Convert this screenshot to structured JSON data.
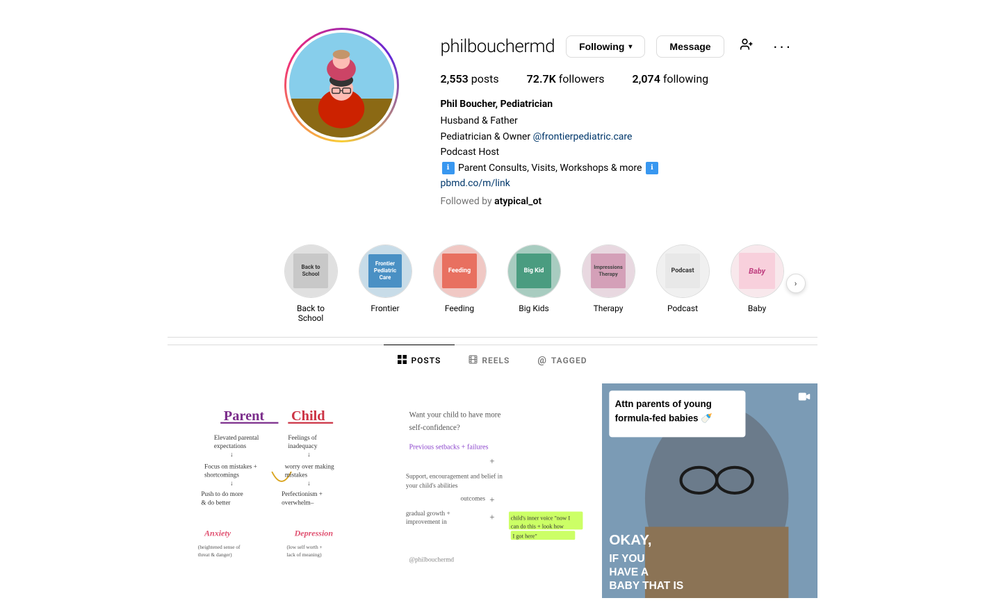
{
  "profile": {
    "username": "philbouchermd",
    "following_button": "Following",
    "message_button": "Message",
    "stats": {
      "posts_count": "2,553",
      "posts_label": "posts",
      "followers_count": "72.7K",
      "followers_label": "followers",
      "following_count": "2,074",
      "following_label": "following"
    },
    "bio": {
      "name": "Phil Boucher, Pediatrician",
      "line1": "Husband & Father",
      "line2": "Pediatrician & Owner @frontierpediatric.care",
      "line3": "Podcast Host",
      "line4": "Parent Consults, Visits, Workshops & more",
      "link": "pbmd.co/m/link",
      "followed_by": "Followed by",
      "follower_name": "atypical_ot"
    }
  },
  "highlights": [
    {
      "id": "back-to-school",
      "label": "Back to School",
      "bg_color": "#d4d4d4",
      "note_color": "#c8c8c8",
      "note_text": "Back to School",
      "note_text_color": "#333"
    },
    {
      "id": "frontier",
      "label": "Frontier",
      "bg_color": "#b8d4e8",
      "note_color": "#4a90c4",
      "note_text": "Frontier Pediatric Care",
      "note_text_color": "#fff"
    },
    {
      "id": "feeding",
      "label": "Feeding",
      "bg_color": "#e8b4b0",
      "note_color": "#e87060",
      "note_text": "Feeding",
      "note_text_color": "#fff"
    },
    {
      "id": "big-kids",
      "label": "Big Kids",
      "bg_color": "#b0d4c8",
      "note_color": "#4a9c80",
      "note_text": "Big Kid",
      "note_text_color": "#fff"
    },
    {
      "id": "therapy",
      "label": "Therapy",
      "bg_color": "#e0c8e0",
      "note_color": "#d4a0b8",
      "note_text": "Impressions Therapy",
      "note_text_color": "#555"
    },
    {
      "id": "podcast",
      "label": "Podcast",
      "bg_color": "#e8e8e8",
      "note_color": "#f0f0f0",
      "note_text": "Podcast",
      "note_text_color": "#333"
    },
    {
      "id": "baby",
      "label": "Baby",
      "bg_color": "#f0d8e0",
      "note_color": "#f8c8d8",
      "note_text": "Baby",
      "note_text_color": "#c04080"
    }
  ],
  "tabs": [
    {
      "id": "posts",
      "label": "POSTS",
      "icon": "⊞",
      "active": true
    },
    {
      "id": "reels",
      "label": "REELS",
      "icon": "▶",
      "active": false
    },
    {
      "id": "tagged",
      "label": "TAGGED",
      "icon": "◉",
      "active": false
    }
  ],
  "posts": [
    {
      "id": "post-1",
      "type": "image",
      "description": "Whiteboard drawing about parent-child anxiety",
      "bg": "#ffffff"
    },
    {
      "id": "post-2",
      "type": "image",
      "description": "Child confidence whiteboard notes",
      "bg": "#ffffff"
    },
    {
      "id": "post-3",
      "type": "video",
      "description": "Formula-fed babies attention photo with text",
      "bg": "#8B9DC3",
      "overlay_text": "Attn parents of young formula-fed babies 🍼",
      "big_text": "OKAY, IF YOU HAVE A BABY THAT IS UNDER THREE MONTHS"
    }
  ],
  "colors": {
    "accent_blue": "#3897f0",
    "border": "#dbdbdb",
    "text_gray": "#737373",
    "dark": "#000000",
    "highlight_active": "#000000"
  }
}
